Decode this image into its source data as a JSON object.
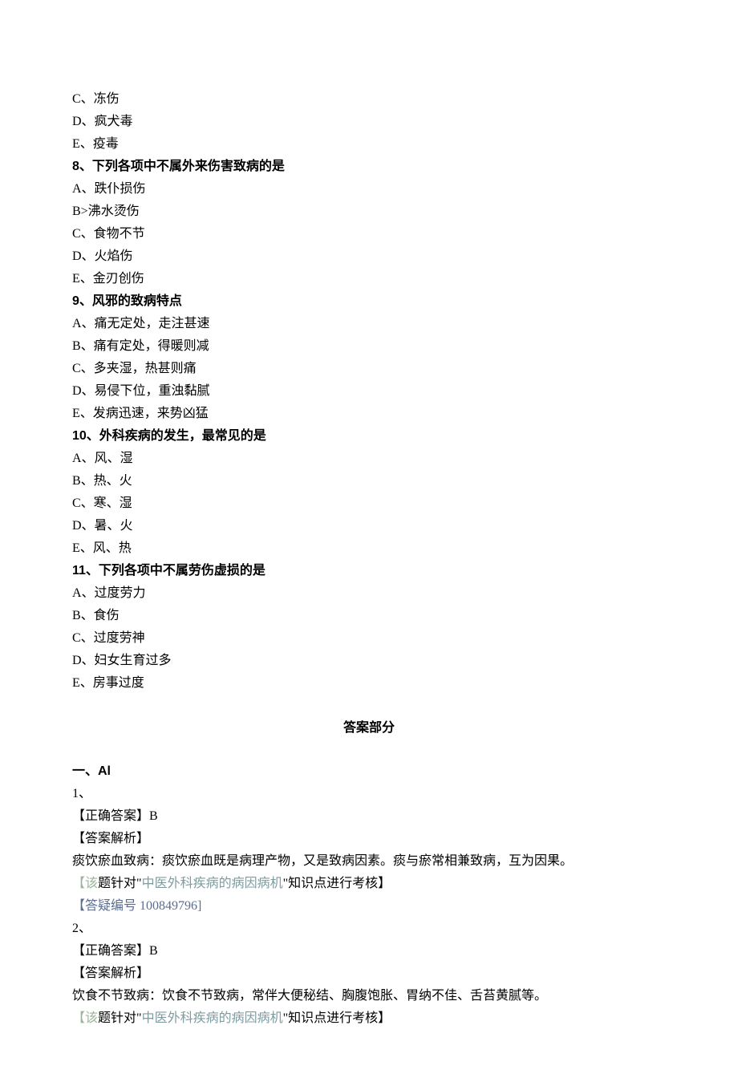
{
  "q7_partial": {
    "optC": "C、冻伤",
    "optD": "D、疯犬毒",
    "optE": "E、疫毒"
  },
  "q8": {
    "title": "8、下列各项中不属外来伤害致病的是",
    "optA": "A、跌仆损伤",
    "optB": "B>沸水烫伤",
    "optC": "C、食物不节",
    "optD": "D、火焰伤",
    "optE": "E、金刃创伤"
  },
  "q9": {
    "title": "9、风邪的致病特点",
    "optA": "A、痛无定处，走注甚速",
    "optB": "B、痛有定处，得暖则减",
    "optC": "C、多夹湿，热甚则痛",
    "optD": "D、易侵下位，重浊黏腻",
    "optE": "E、发病迅速，来势凶猛"
  },
  "q10": {
    "title": "10、外科疾病的发生，最常见的是",
    "optA": "A、风、湿",
    "optB": "B、热、火",
    "optC": "C、寒、湿",
    "optD": "D、暑、火",
    "optE": "E、风、热"
  },
  "q11": {
    "title": "11、下列各项中不属劳伤虚损的是",
    "optA": "A、过度劳力",
    "optB": "B、食伤",
    "optC": "C、过度劳神",
    "optD": "D、妇女生育过多",
    "optE": "E、房事过度"
  },
  "answers": {
    "header": "答案部分",
    "section": "一、Al",
    "a1": {
      "num": "1、",
      "correct": "【正确答案】B",
      "analysis_label": "【答案解析】",
      "analysis_text": "痰饮瘀血致病：痰饮瘀血既是病理产物，又是致病因素。痰与瘀常相兼致病，互为因果。",
      "note_pre": "【该",
      "note_mid1": "题针对\"",
      "note_topic": "中医外科疾病的病因病机",
      "note_tail": "\"知识点进行考核】",
      "ref_pre": "【答疑",
      "ref_tail": "编号 100849796]"
    },
    "a2": {
      "num": "2、",
      "correct": "【正确答案】B",
      "analysis_label": "【答案解析】",
      "analysis_text": "饮食不节致病：饮食不节致病，常伴大便秘结、胸腹饱胀、胃纳不佳、舌苔黄腻等。",
      "note_pre": "【该",
      "note_mid1": "题针对\"",
      "note_topic": "中医外科疾病的病因病机",
      "note_tail": "\"知识点进行考核】"
    }
  }
}
